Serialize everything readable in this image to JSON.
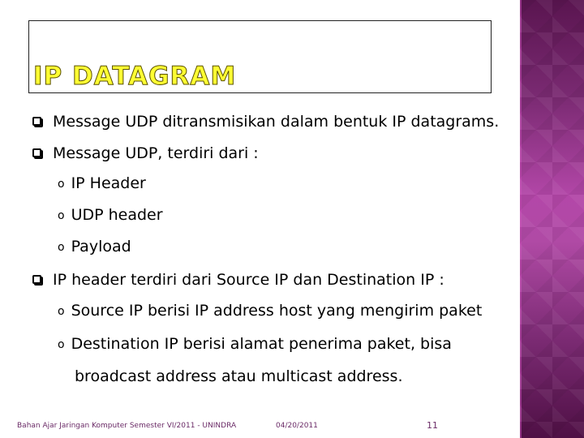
{
  "slide": {
    "title": "IP DATAGRAM",
    "bullets": [
      {
        "level": 1,
        "marker": "checkbox-square",
        "text": "Message UDP ditransmisikan dalam bentuk IP datagrams."
      },
      {
        "level": 1,
        "marker": "checkbox-square",
        "text": "Message UDP, terdiri dari :"
      },
      {
        "level": 2,
        "marker": "circle",
        "text": "IP Header"
      },
      {
        "level": 2,
        "marker": "circle",
        "text": "UDP header"
      },
      {
        "level": 2,
        "marker": "circle",
        "text": "Payload"
      },
      {
        "level": 1,
        "marker": "checkbox-square",
        "text": "IP header terdiri dari Source IP dan Destination IP :"
      },
      {
        "level": 2,
        "marker": "circle",
        "text": "Source IP berisi IP address host yang mengirim paket"
      },
      {
        "level": 2,
        "marker": "circle",
        "text": "Destination IP berisi alamat penerima paket, bisa"
      },
      {
        "level": 2,
        "marker": "none",
        "text": "broadcast address atau multicast address."
      }
    ],
    "circle_glyph": "o"
  },
  "footer": {
    "course": "Bahan Ajar Jaringan Komputer Semester VI/2011 - UNINDRA",
    "date": "04/20/2011",
    "page_number": "11"
  },
  "colors": {
    "title_fill": "#ffff33",
    "sidebar": "#8e3585",
    "footer_text": "#6a2a66"
  }
}
